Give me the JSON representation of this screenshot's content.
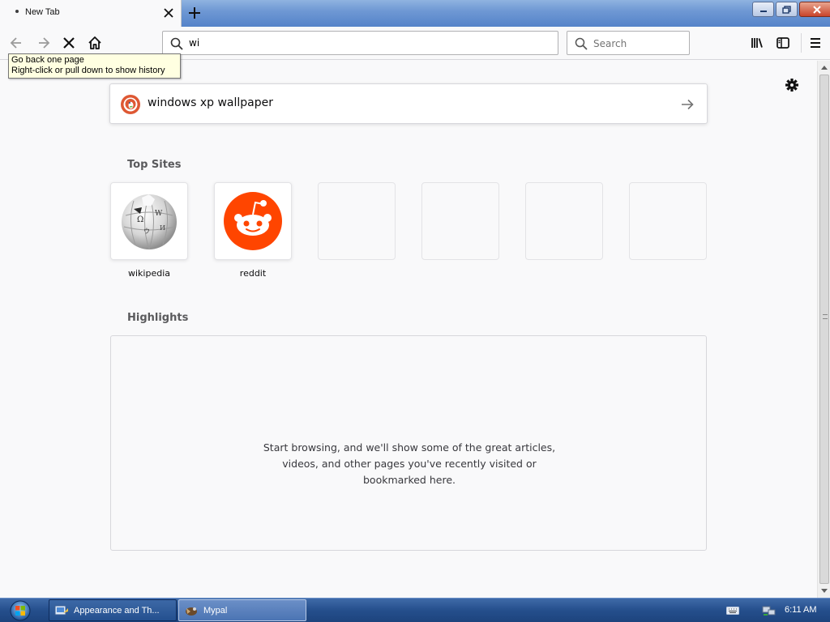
{
  "browser": {
    "tab": {
      "title": "New Tab"
    },
    "url_bar": {
      "value": "wi"
    },
    "search_bar": {
      "placeholder": "Search"
    },
    "tooltip": {
      "line1": "Go back one page",
      "line2": "Right-click or pull down to show history"
    }
  },
  "newtab": {
    "search_suggestion": "windows xp wallpaper",
    "top_sites_title": "Top Sites",
    "top_sites": [
      {
        "label": "wikipedia",
        "icon": "wikipedia-logo"
      },
      {
        "label": "reddit",
        "icon": "reddit-logo"
      },
      {
        "label": ""
      },
      {
        "label": ""
      },
      {
        "label": ""
      },
      {
        "label": ""
      }
    ],
    "highlights_title": "Highlights",
    "highlights_message": [
      "Start browsing, and we'll show some of the great articles,",
      "videos, and other pages you've recently visited or",
      "bookmarked here."
    ]
  },
  "taskbar": {
    "items": [
      {
        "label": "Appearance and Th...",
        "icon": "control-panel-icon"
      },
      {
        "label": "Mypal",
        "icon": "mypal-icon"
      }
    ],
    "clock": "6:11 AM"
  },
  "colors": {
    "reddit_orange": "#ff4500",
    "page_bg": "#f9f9fa",
    "taskbar_blue": "#254f8c"
  }
}
